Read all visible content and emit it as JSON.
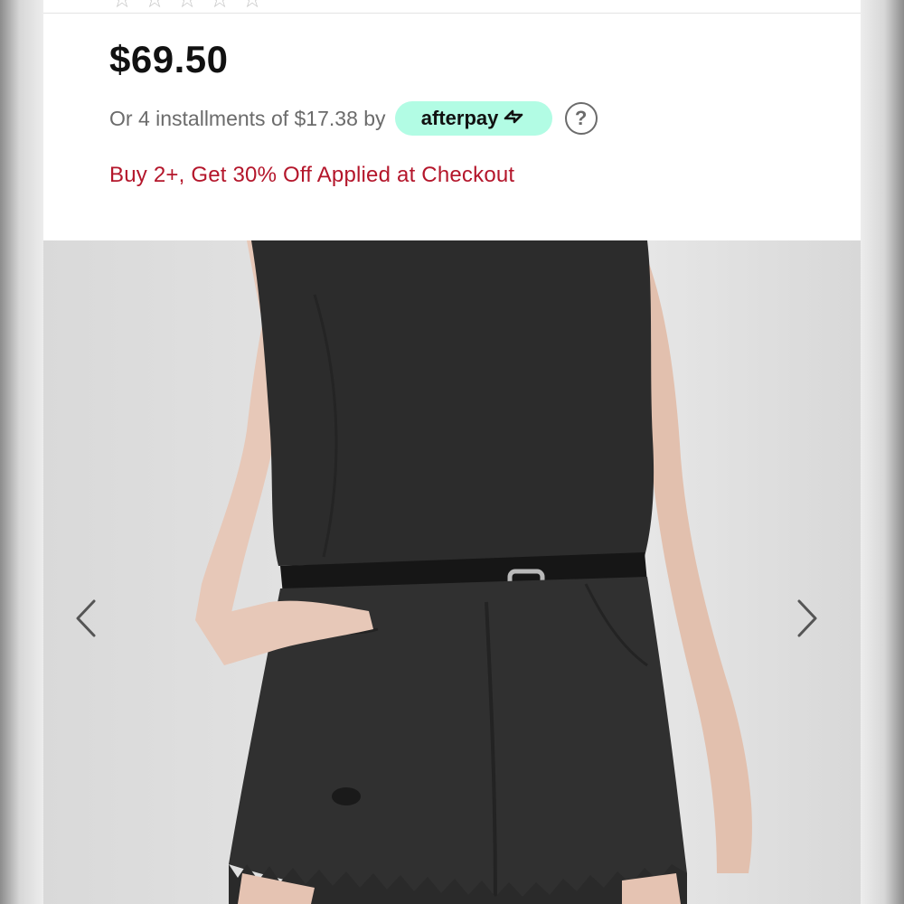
{
  "product": {
    "price": "$69.50",
    "installments_text": "Or 4 installments of $17.38 by",
    "afterpay_label": "afterpay",
    "afterpay_icon": "afterpay-arrows-icon",
    "help_icon": "question-icon",
    "promo_text": "Buy 2+, Get 30% Off Applied at Checkout",
    "rating_icon": "star-icon"
  },
  "gallery": {
    "prev_icon": "chevron-left-icon",
    "next_icon": "chevron-right-icon"
  },
  "colors": {
    "price": "#111111",
    "muted_text": "#6b6b6b",
    "promo": "#b4162b",
    "afterpay_badge": "#b2fce4"
  }
}
